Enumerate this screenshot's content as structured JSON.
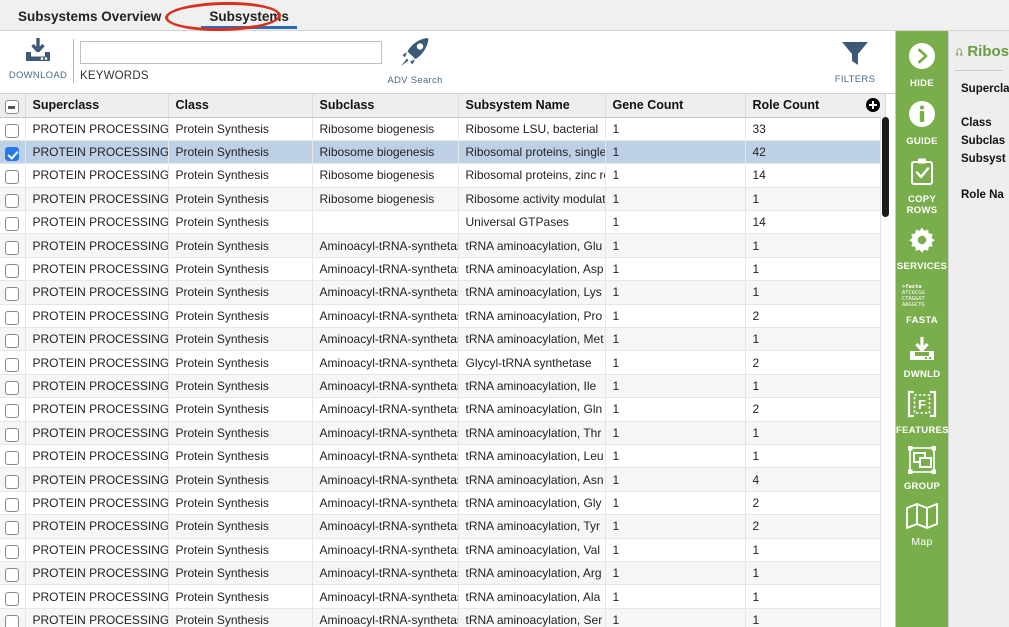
{
  "tabs": [
    {
      "label": "Subsystems Overview",
      "active": false
    },
    {
      "label": "Subsystems",
      "active": true
    }
  ],
  "annotation": {
    "shape": "ellipse",
    "color": "#d9301b",
    "targets": "Subsystems"
  },
  "toolbar": {
    "download_label": "DOWNLOAD",
    "download_icon": "download-icon",
    "keywords_label": "KEYWORDS",
    "search_value": "",
    "search_placeholder": "",
    "adv_search_label": "ADV Search",
    "adv_search_icon": "rocket-icon",
    "filters_label": "FILTERS",
    "filters_icon": "funnel-icon"
  },
  "table": {
    "columns": [
      "Superclass",
      "Class",
      "Subclass",
      "Subsystem Name",
      "Gene Count",
      "Role Count"
    ],
    "header_checkbox_state": "indeterminate",
    "add_column_icon": "plus-circle-icon",
    "rows": [
      {
        "selected": false,
        "superclass": "PROTEIN PROCESSING",
        "class": "Protein Synthesis",
        "subclass": "Ribosome biogenesis",
        "subsystem": "Ribosome LSU, bacterial",
        "gene_count": "1",
        "role_count": "33"
      },
      {
        "selected": true,
        "superclass": "PROTEIN PROCESSING",
        "class": "Protein Synthesis",
        "subclass": "Ribosome biogenesis",
        "subsystem": "Ribosomal proteins, single-co",
        "gene_count": "1",
        "role_count": "42"
      },
      {
        "selected": false,
        "superclass": "PROTEIN PROCESSING",
        "class": "Protein Synthesis",
        "subclass": "Ribosome biogenesis",
        "subsystem": "Ribosomal proteins, zinc requ",
        "gene_count": "1",
        "role_count": "14"
      },
      {
        "selected": false,
        "superclass": "PROTEIN PROCESSING",
        "class": "Protein Synthesis",
        "subclass": "Ribosome biogenesis",
        "subsystem": "Ribosome activity modulation",
        "gene_count": "1",
        "role_count": "1"
      },
      {
        "selected": false,
        "superclass": "PROTEIN PROCESSING",
        "class": "Protein Synthesis",
        "subclass": "",
        "subsystem": "Universal GTPases",
        "gene_count": "1",
        "role_count": "14"
      },
      {
        "selected": false,
        "superclass": "PROTEIN PROCESSING",
        "class": "Protein Synthesis",
        "subclass": "Aminoacyl-tRNA-synthetases",
        "subsystem": "tRNA aminoacylation, Glu",
        "gene_count": "1",
        "role_count": "1"
      },
      {
        "selected": false,
        "superclass": "PROTEIN PROCESSING",
        "class": "Protein Synthesis",
        "subclass": "Aminoacyl-tRNA-synthetases",
        "subsystem": "tRNA aminoacylation, Asp",
        "gene_count": "1",
        "role_count": "1"
      },
      {
        "selected": false,
        "superclass": "PROTEIN PROCESSING",
        "class": "Protein Synthesis",
        "subclass": "Aminoacyl-tRNA-synthetases",
        "subsystem": "tRNA aminoacylation, Lys",
        "gene_count": "1",
        "role_count": "1"
      },
      {
        "selected": false,
        "superclass": "PROTEIN PROCESSING",
        "class": "Protein Synthesis",
        "subclass": "Aminoacyl-tRNA-synthetases",
        "subsystem": "tRNA aminoacylation, Pro",
        "gene_count": "1",
        "role_count": "2"
      },
      {
        "selected": false,
        "superclass": "PROTEIN PROCESSING",
        "class": "Protein Synthesis",
        "subclass": "Aminoacyl-tRNA-synthetases",
        "subsystem": "tRNA aminoacylation, Met",
        "gene_count": "1",
        "role_count": "1"
      },
      {
        "selected": false,
        "superclass": "PROTEIN PROCESSING",
        "class": "Protein Synthesis",
        "subclass": "Aminoacyl-tRNA-synthetases",
        "subsystem": "Glycyl-tRNA synthetase",
        "gene_count": "1",
        "role_count": "2"
      },
      {
        "selected": false,
        "superclass": "PROTEIN PROCESSING",
        "class": "Protein Synthesis",
        "subclass": "Aminoacyl-tRNA-synthetases",
        "subsystem": "tRNA aminoacylation, Ile",
        "gene_count": "1",
        "role_count": "1"
      },
      {
        "selected": false,
        "superclass": "PROTEIN PROCESSING",
        "class": "Protein Synthesis",
        "subclass": "Aminoacyl-tRNA-synthetases",
        "subsystem": "tRNA aminoacylation, Gln",
        "gene_count": "1",
        "role_count": "2"
      },
      {
        "selected": false,
        "superclass": "PROTEIN PROCESSING",
        "class": "Protein Synthesis",
        "subclass": "Aminoacyl-tRNA-synthetases",
        "subsystem": "tRNA aminoacylation, Thr",
        "gene_count": "1",
        "role_count": "1"
      },
      {
        "selected": false,
        "superclass": "PROTEIN PROCESSING",
        "class": "Protein Synthesis",
        "subclass": "Aminoacyl-tRNA-synthetases",
        "subsystem": "tRNA aminoacylation, Leu",
        "gene_count": "1",
        "role_count": "1"
      },
      {
        "selected": false,
        "superclass": "PROTEIN PROCESSING",
        "class": "Protein Synthesis",
        "subclass": "Aminoacyl-tRNA-synthetases",
        "subsystem": "tRNA aminoacylation, Asn",
        "gene_count": "1",
        "role_count": "4"
      },
      {
        "selected": false,
        "superclass": "PROTEIN PROCESSING",
        "class": "Protein Synthesis",
        "subclass": "Aminoacyl-tRNA-synthetases",
        "subsystem": "tRNA aminoacylation, Gly",
        "gene_count": "1",
        "role_count": "2"
      },
      {
        "selected": false,
        "superclass": "PROTEIN PROCESSING",
        "class": "Protein Synthesis",
        "subclass": "Aminoacyl-tRNA-synthetases",
        "subsystem": "tRNA aminoacylation, Tyr",
        "gene_count": "1",
        "role_count": "2"
      },
      {
        "selected": false,
        "superclass": "PROTEIN PROCESSING",
        "class": "Protein Synthesis",
        "subclass": "Aminoacyl-tRNA-synthetases",
        "subsystem": "tRNA aminoacylation, Val",
        "gene_count": "1",
        "role_count": "1"
      },
      {
        "selected": false,
        "superclass": "PROTEIN PROCESSING",
        "class": "Protein Synthesis",
        "subclass": "Aminoacyl-tRNA-synthetases",
        "subsystem": "tRNA aminoacylation, Arg",
        "gene_count": "1",
        "role_count": "1"
      },
      {
        "selected": false,
        "superclass": "PROTEIN PROCESSING",
        "class": "Protein Synthesis",
        "subclass": "Aminoacyl-tRNA-synthetases",
        "subsystem": "tRNA aminoacylation, Ala",
        "gene_count": "1",
        "role_count": "1"
      },
      {
        "selected": false,
        "superclass": "PROTEIN PROCESSING",
        "class": "Protein Synthesis",
        "subclass": "Aminoacyl-tRNA-synthetases",
        "subsystem": "tRNA aminoacylation, Ser",
        "gene_count": "1",
        "role_count": "1"
      }
    ]
  },
  "rail": {
    "background": "#7aad4c",
    "items": [
      {
        "label": "HIDE",
        "icon": "chevron-right-circle-icon"
      },
      {
        "label": "GUIDE",
        "icon": "info-circle-icon"
      },
      {
        "label": "COPY ROWS",
        "icon": "clipboard-check-icon"
      },
      {
        "label": "SERVICES",
        "icon": "gear-icon"
      },
      {
        "label": "FASTA",
        "icon": "fasta-text-icon"
      },
      {
        "label": "DWNLD",
        "icon": "download-icon"
      },
      {
        "label": "FEATURES",
        "icon": "features-bracket-icon"
      },
      {
        "label": "GROUP",
        "icon": "group-shapes-icon"
      },
      {
        "label": "Map",
        "icon": "map-icon"
      }
    ]
  },
  "detail": {
    "title": "Ribos",
    "title_icon": "subsystem-branch-icon",
    "title_color": "#6b9b3f",
    "fields": [
      "Superclas",
      "Class",
      "Subclas",
      "Subsyst",
      "Role Na"
    ]
  }
}
